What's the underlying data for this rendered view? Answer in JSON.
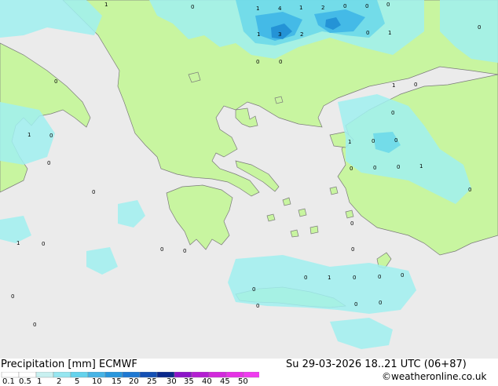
{
  "map": {
    "sea_color": "#ebebeb",
    "land_color": "#c8f5a0",
    "precip_colors": [
      "#ffffff",
      "#a0f0f0",
      "#6ad8ea",
      "#3cb4e6",
      "#1e8cd2",
      "#1464be"
    ],
    "value_labels": [
      {
        "text": "1"
      },
      {
        "text": "0"
      },
      {
        "text": "1"
      },
      {
        "text": "4"
      },
      {
        "text": "1"
      },
      {
        "text": "2"
      },
      {
        "text": "0"
      },
      {
        "text": "0"
      },
      {
        "text": "0"
      },
      {
        "text": "1"
      },
      {
        "text": "3"
      },
      {
        "text": "2"
      },
      {
        "text": "0"
      },
      {
        "text": "1"
      },
      {
        "text": "0"
      },
      {
        "text": "0"
      },
      {
        "text": "0"
      },
      {
        "text": "0"
      },
      {
        "text": "1"
      },
      {
        "text": "0"
      },
      {
        "text": "1"
      },
      {
        "text": "0"
      },
      {
        "text": "0"
      },
      {
        "text": "1"
      },
      {
        "text": "0"
      },
      {
        "text": "0"
      },
      {
        "text": "1"
      },
      {
        "text": "0"
      },
      {
        "text": "0"
      },
      {
        "text": "0"
      },
      {
        "text": "0"
      },
      {
        "text": "0"
      },
      {
        "text": "1"
      },
      {
        "text": "0"
      },
      {
        "text": "0"
      },
      {
        "text": "0"
      },
      {
        "text": "0"
      },
      {
        "text": "0"
      },
      {
        "text": "0"
      },
      {
        "text": "1"
      },
      {
        "text": "0"
      },
      {
        "text": "0"
      },
      {
        "text": "0"
      },
      {
        "text": "0"
      },
      {
        "text": "0"
      },
      {
        "text": "0"
      },
      {
        "text": "0"
      },
      {
        "text": "0"
      },
      {
        "text": "0"
      },
      {
        "text": "0"
      }
    ]
  },
  "footer": {
    "title": "Precipitation [mm] ECMWF",
    "datetime": "Su 29-03-2026 18..21 UTC (06+87)",
    "credit": "©weatheronline.co.uk",
    "scale_ticks": [
      "0.1",
      "0.5",
      "1",
      "2",
      "5",
      "10",
      "15",
      "20",
      "25",
      "30",
      "35",
      "40",
      "45",
      "50"
    ],
    "scale_colors": [
      "#ffffff",
      "#ffffff",
      "#c8f0f0",
      "#96e6f0",
      "#64d2ec",
      "#46b4e6",
      "#2896dc",
      "#1e78d2",
      "#1450b4",
      "#0a288c",
      "#8c14c8",
      "#b41ed2",
      "#d228dc",
      "#e632e6",
      "#f03cf0"
    ]
  }
}
